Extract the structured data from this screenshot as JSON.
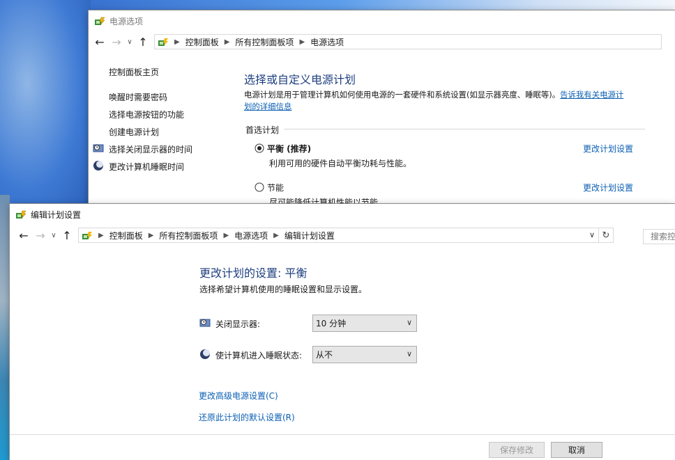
{
  "window_a": {
    "title": "电源选项",
    "breadcrumb": [
      "控制面板",
      "所有控制面板项",
      "电源选项"
    ],
    "sidebar": {
      "home": "控制面板主页",
      "links": [
        "唤醒时需要密码",
        "选择电源按钮的功能",
        "创建电源计划",
        "选择关闭显示器的时间",
        "更改计算机睡眠时间"
      ]
    },
    "heading": "选择或自定义电源计划",
    "desc_line1": "电源计划是用于管理计算机如何使用电源的一套硬件和系统设置(如显示器亮度、睡眠等)。",
    "desc_link_part1": "告诉我有关电源计",
    "desc_link_part2": "划的详细信息",
    "group_title": "首选计划",
    "plans": [
      {
        "name": "平衡 (推荐)",
        "desc": "利用可用的硬件自动平衡功耗与性能。",
        "selected": true,
        "action": "更改计划设置"
      },
      {
        "name": "节能",
        "desc": "尽可能降低计算机性能以节能。",
        "selected": false,
        "action": "更改计划设置"
      }
    ]
  },
  "window_b": {
    "title": "编辑计划设置",
    "breadcrumb": [
      "控制面板",
      "所有控制面板项",
      "电源选项",
      "编辑计划设置"
    ],
    "search_placeholder": "搜索控",
    "heading": "更改计划的设置: 平衡",
    "subheading": "选择希望计算机使用的睡眠设置和显示设置。",
    "display_label": "关闭显示器:",
    "display_value": "10 分钟",
    "sleep_label": "使计算机进入睡眠状态:",
    "sleep_value": "从不",
    "advanced_link": "更改高级电源设置(C)",
    "restore_link": "还原此计划的默认设置(R)",
    "save_button": "保存修改",
    "cancel_button": "取消"
  },
  "colors": {
    "link": "#0b5fb3",
    "heading": "#1e3f80",
    "disabled_text": "#9a9a9a"
  }
}
